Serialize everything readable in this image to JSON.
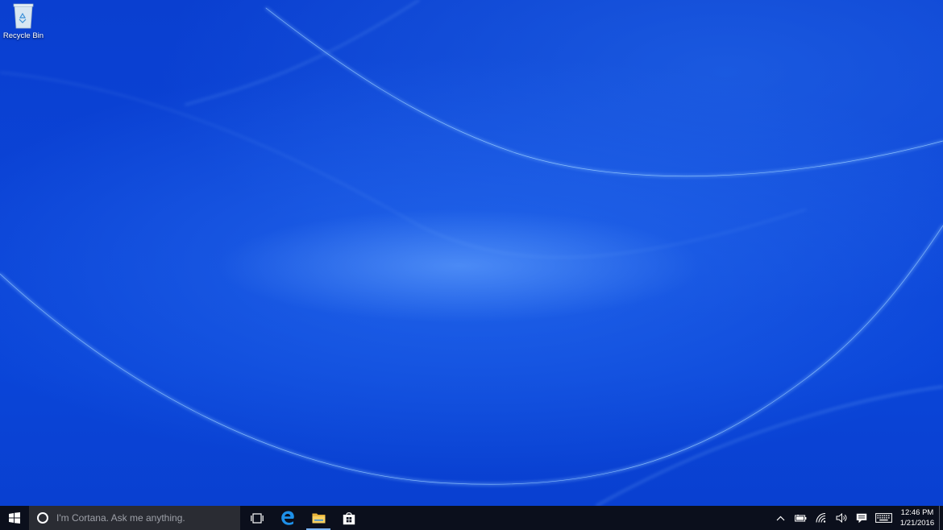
{
  "desktop": {
    "icons": [
      {
        "label": "Recycle Bin",
        "icon": "recycle-bin-icon"
      }
    ],
    "wallpaper": {
      "base_color": "#0a43d6",
      "highlight_color": "#6fb0ff"
    }
  },
  "taskbar": {
    "background": "#0b0f1c",
    "start": {
      "icon": "windows-logo-icon"
    },
    "search": {
      "placeholder": "I'm Cortana. Ask me anything.",
      "icon": "cortana-circle-icon"
    },
    "pinned": [
      {
        "name": "Task View",
        "icon": "task-view-icon"
      },
      {
        "name": "Microsoft Edge",
        "icon": "edge-icon",
        "accent": "#1e90e8"
      },
      {
        "name": "File Explorer",
        "icon": "folder-icon",
        "accent": "#f3c544",
        "active": true
      },
      {
        "name": "Store",
        "icon": "store-icon"
      }
    ],
    "tray": {
      "icons": [
        "chevron-up-icon",
        "battery-icon",
        "wifi-icon",
        "volume-icon",
        "action-center-icon",
        "keyboard-icon"
      ],
      "time": "12:46 PM",
      "date": "1/21/2016"
    }
  }
}
